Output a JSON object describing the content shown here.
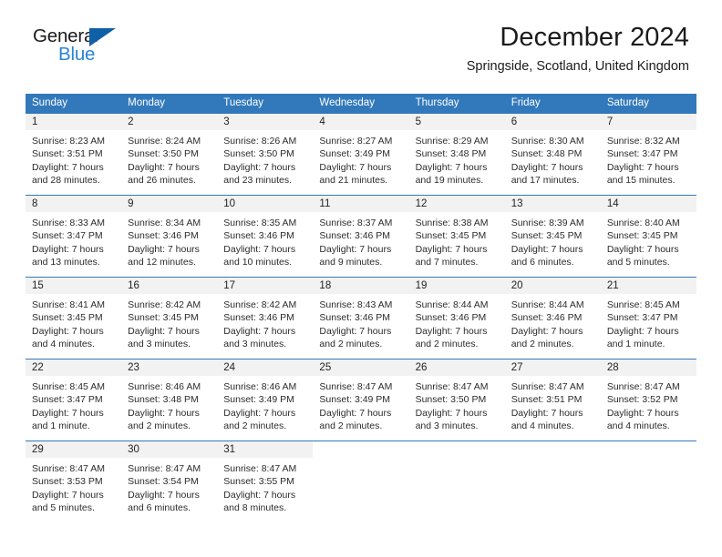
{
  "logo": {
    "word_one": "General",
    "word_two": "Blue",
    "triangle_icon": "blue-triangle-icon",
    "accent_dark": "#1060a8",
    "accent_light": "#2a84d2"
  },
  "header": {
    "title": "December 2024",
    "subtitle": "Springside, Scotland, United Kingdom"
  },
  "theme": {
    "header_blue": "#3279bb",
    "daynum_band": "#f2f2f2",
    "text": "#2b2b2b"
  },
  "calendar": {
    "weekday_headers": [
      "Sunday",
      "Monday",
      "Tuesday",
      "Wednesday",
      "Thursday",
      "Friday",
      "Saturday"
    ],
    "weeks": [
      [
        {
          "day": "1",
          "sunrise": "Sunrise: 8:23 AM",
          "sunset": "Sunset: 3:51 PM",
          "daylight_line1": "Daylight: 7 hours",
          "daylight_line2": "and 28 minutes."
        },
        {
          "day": "2",
          "sunrise": "Sunrise: 8:24 AM",
          "sunset": "Sunset: 3:50 PM",
          "daylight_line1": "Daylight: 7 hours",
          "daylight_line2": "and 26 minutes."
        },
        {
          "day": "3",
          "sunrise": "Sunrise: 8:26 AM",
          "sunset": "Sunset: 3:50 PM",
          "daylight_line1": "Daylight: 7 hours",
          "daylight_line2": "and 23 minutes."
        },
        {
          "day": "4",
          "sunrise": "Sunrise: 8:27 AM",
          "sunset": "Sunset: 3:49 PM",
          "daylight_line1": "Daylight: 7 hours",
          "daylight_line2": "and 21 minutes."
        },
        {
          "day": "5",
          "sunrise": "Sunrise: 8:29 AM",
          "sunset": "Sunset: 3:48 PM",
          "daylight_line1": "Daylight: 7 hours",
          "daylight_line2": "and 19 minutes."
        },
        {
          "day": "6",
          "sunrise": "Sunrise: 8:30 AM",
          "sunset": "Sunset: 3:48 PM",
          "daylight_line1": "Daylight: 7 hours",
          "daylight_line2": "and 17 minutes."
        },
        {
          "day": "7",
          "sunrise": "Sunrise: 8:32 AM",
          "sunset": "Sunset: 3:47 PM",
          "daylight_line1": "Daylight: 7 hours",
          "daylight_line2": "and 15 minutes."
        }
      ],
      [
        {
          "day": "8",
          "sunrise": "Sunrise: 8:33 AM",
          "sunset": "Sunset: 3:47 PM",
          "daylight_line1": "Daylight: 7 hours",
          "daylight_line2": "and 13 minutes."
        },
        {
          "day": "9",
          "sunrise": "Sunrise: 8:34 AM",
          "sunset": "Sunset: 3:46 PM",
          "daylight_line1": "Daylight: 7 hours",
          "daylight_line2": "and 12 minutes."
        },
        {
          "day": "10",
          "sunrise": "Sunrise: 8:35 AM",
          "sunset": "Sunset: 3:46 PM",
          "daylight_line1": "Daylight: 7 hours",
          "daylight_line2": "and 10 minutes."
        },
        {
          "day": "11",
          "sunrise": "Sunrise: 8:37 AM",
          "sunset": "Sunset: 3:46 PM",
          "daylight_line1": "Daylight: 7 hours",
          "daylight_line2": "and 9 minutes."
        },
        {
          "day": "12",
          "sunrise": "Sunrise: 8:38 AM",
          "sunset": "Sunset: 3:45 PM",
          "daylight_line1": "Daylight: 7 hours",
          "daylight_line2": "and 7 minutes."
        },
        {
          "day": "13",
          "sunrise": "Sunrise: 8:39 AM",
          "sunset": "Sunset: 3:45 PM",
          "daylight_line1": "Daylight: 7 hours",
          "daylight_line2": "and 6 minutes."
        },
        {
          "day": "14",
          "sunrise": "Sunrise: 8:40 AM",
          "sunset": "Sunset: 3:45 PM",
          "daylight_line1": "Daylight: 7 hours",
          "daylight_line2": "and 5 minutes."
        }
      ],
      [
        {
          "day": "15",
          "sunrise": "Sunrise: 8:41 AM",
          "sunset": "Sunset: 3:45 PM",
          "daylight_line1": "Daylight: 7 hours",
          "daylight_line2": "and 4 minutes."
        },
        {
          "day": "16",
          "sunrise": "Sunrise: 8:42 AM",
          "sunset": "Sunset: 3:45 PM",
          "daylight_line1": "Daylight: 7 hours",
          "daylight_line2": "and 3 minutes."
        },
        {
          "day": "17",
          "sunrise": "Sunrise: 8:42 AM",
          "sunset": "Sunset: 3:46 PM",
          "daylight_line1": "Daylight: 7 hours",
          "daylight_line2": "and 3 minutes."
        },
        {
          "day": "18",
          "sunrise": "Sunrise: 8:43 AM",
          "sunset": "Sunset: 3:46 PM",
          "daylight_line1": "Daylight: 7 hours",
          "daylight_line2": "and 2 minutes."
        },
        {
          "day": "19",
          "sunrise": "Sunrise: 8:44 AM",
          "sunset": "Sunset: 3:46 PM",
          "daylight_line1": "Daylight: 7 hours",
          "daylight_line2": "and 2 minutes."
        },
        {
          "day": "20",
          "sunrise": "Sunrise: 8:44 AM",
          "sunset": "Sunset: 3:46 PM",
          "daylight_line1": "Daylight: 7 hours",
          "daylight_line2": "and 2 minutes."
        },
        {
          "day": "21",
          "sunrise": "Sunrise: 8:45 AM",
          "sunset": "Sunset: 3:47 PM",
          "daylight_line1": "Daylight: 7 hours",
          "daylight_line2": "and 1 minute."
        }
      ],
      [
        {
          "day": "22",
          "sunrise": "Sunrise: 8:45 AM",
          "sunset": "Sunset: 3:47 PM",
          "daylight_line1": "Daylight: 7 hours",
          "daylight_line2": "and 1 minute."
        },
        {
          "day": "23",
          "sunrise": "Sunrise: 8:46 AM",
          "sunset": "Sunset: 3:48 PM",
          "daylight_line1": "Daylight: 7 hours",
          "daylight_line2": "and 2 minutes."
        },
        {
          "day": "24",
          "sunrise": "Sunrise: 8:46 AM",
          "sunset": "Sunset: 3:49 PM",
          "daylight_line1": "Daylight: 7 hours",
          "daylight_line2": "and 2 minutes."
        },
        {
          "day": "25",
          "sunrise": "Sunrise: 8:47 AM",
          "sunset": "Sunset: 3:49 PM",
          "daylight_line1": "Daylight: 7 hours",
          "daylight_line2": "and 2 minutes."
        },
        {
          "day": "26",
          "sunrise": "Sunrise: 8:47 AM",
          "sunset": "Sunset: 3:50 PM",
          "daylight_line1": "Daylight: 7 hours",
          "daylight_line2": "and 3 minutes."
        },
        {
          "day": "27",
          "sunrise": "Sunrise: 8:47 AM",
          "sunset": "Sunset: 3:51 PM",
          "daylight_line1": "Daylight: 7 hours",
          "daylight_line2": "and 4 minutes."
        },
        {
          "day": "28",
          "sunrise": "Sunrise: 8:47 AM",
          "sunset": "Sunset: 3:52 PM",
          "daylight_line1": "Daylight: 7 hours",
          "daylight_line2": "and 4 minutes."
        }
      ],
      [
        {
          "day": "29",
          "sunrise": "Sunrise: 8:47 AM",
          "sunset": "Sunset: 3:53 PM",
          "daylight_line1": "Daylight: 7 hours",
          "daylight_line2": "and 5 minutes."
        },
        {
          "day": "30",
          "sunrise": "Sunrise: 8:47 AM",
          "sunset": "Sunset: 3:54 PM",
          "daylight_line1": "Daylight: 7 hours",
          "daylight_line2": "and 6 minutes."
        },
        {
          "day": "31",
          "sunrise": "Sunrise: 8:47 AM",
          "sunset": "Sunset: 3:55 PM",
          "daylight_line1": "Daylight: 7 hours",
          "daylight_line2": "and 8 minutes."
        },
        {
          "day": "",
          "sunrise": "",
          "sunset": "",
          "daylight_line1": "",
          "daylight_line2": ""
        },
        {
          "day": "",
          "sunrise": "",
          "sunset": "",
          "daylight_line1": "",
          "daylight_line2": ""
        },
        {
          "day": "",
          "sunrise": "",
          "sunset": "",
          "daylight_line1": "",
          "daylight_line2": ""
        },
        {
          "day": "",
          "sunrise": "",
          "sunset": "",
          "daylight_line1": "",
          "daylight_line2": ""
        }
      ]
    ]
  }
}
